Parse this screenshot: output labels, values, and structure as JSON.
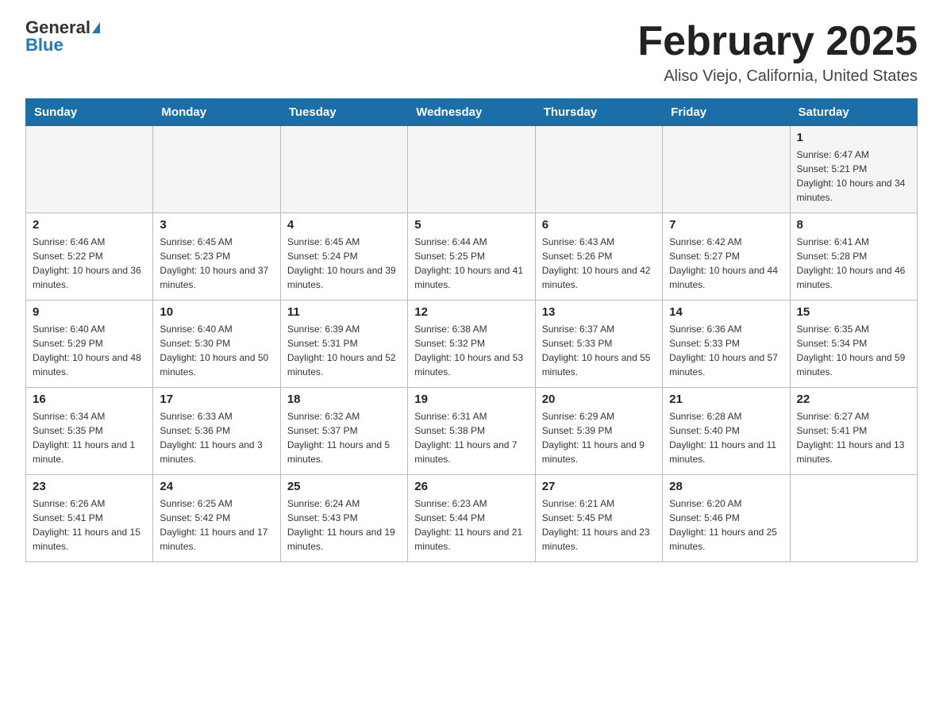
{
  "header": {
    "logo_general": "General",
    "logo_blue": "Blue",
    "month_title": "February 2025",
    "location": "Aliso Viejo, California, United States"
  },
  "days_of_week": [
    "Sunday",
    "Monday",
    "Tuesday",
    "Wednesday",
    "Thursday",
    "Friday",
    "Saturday"
  ],
  "weeks": [
    [
      {
        "day": "",
        "info": ""
      },
      {
        "day": "",
        "info": ""
      },
      {
        "day": "",
        "info": ""
      },
      {
        "day": "",
        "info": ""
      },
      {
        "day": "",
        "info": ""
      },
      {
        "day": "",
        "info": ""
      },
      {
        "day": "1",
        "info": "Sunrise: 6:47 AM\nSunset: 5:21 PM\nDaylight: 10 hours and 34 minutes."
      }
    ],
    [
      {
        "day": "2",
        "info": "Sunrise: 6:46 AM\nSunset: 5:22 PM\nDaylight: 10 hours and 36 minutes."
      },
      {
        "day": "3",
        "info": "Sunrise: 6:45 AM\nSunset: 5:23 PM\nDaylight: 10 hours and 37 minutes."
      },
      {
        "day": "4",
        "info": "Sunrise: 6:45 AM\nSunset: 5:24 PM\nDaylight: 10 hours and 39 minutes."
      },
      {
        "day": "5",
        "info": "Sunrise: 6:44 AM\nSunset: 5:25 PM\nDaylight: 10 hours and 41 minutes."
      },
      {
        "day": "6",
        "info": "Sunrise: 6:43 AM\nSunset: 5:26 PM\nDaylight: 10 hours and 42 minutes."
      },
      {
        "day": "7",
        "info": "Sunrise: 6:42 AM\nSunset: 5:27 PM\nDaylight: 10 hours and 44 minutes."
      },
      {
        "day": "8",
        "info": "Sunrise: 6:41 AM\nSunset: 5:28 PM\nDaylight: 10 hours and 46 minutes."
      }
    ],
    [
      {
        "day": "9",
        "info": "Sunrise: 6:40 AM\nSunset: 5:29 PM\nDaylight: 10 hours and 48 minutes."
      },
      {
        "day": "10",
        "info": "Sunrise: 6:40 AM\nSunset: 5:30 PM\nDaylight: 10 hours and 50 minutes."
      },
      {
        "day": "11",
        "info": "Sunrise: 6:39 AM\nSunset: 5:31 PM\nDaylight: 10 hours and 52 minutes."
      },
      {
        "day": "12",
        "info": "Sunrise: 6:38 AM\nSunset: 5:32 PM\nDaylight: 10 hours and 53 minutes."
      },
      {
        "day": "13",
        "info": "Sunrise: 6:37 AM\nSunset: 5:33 PM\nDaylight: 10 hours and 55 minutes."
      },
      {
        "day": "14",
        "info": "Sunrise: 6:36 AM\nSunset: 5:33 PM\nDaylight: 10 hours and 57 minutes."
      },
      {
        "day": "15",
        "info": "Sunrise: 6:35 AM\nSunset: 5:34 PM\nDaylight: 10 hours and 59 minutes."
      }
    ],
    [
      {
        "day": "16",
        "info": "Sunrise: 6:34 AM\nSunset: 5:35 PM\nDaylight: 11 hours and 1 minute."
      },
      {
        "day": "17",
        "info": "Sunrise: 6:33 AM\nSunset: 5:36 PM\nDaylight: 11 hours and 3 minutes."
      },
      {
        "day": "18",
        "info": "Sunrise: 6:32 AM\nSunset: 5:37 PM\nDaylight: 11 hours and 5 minutes."
      },
      {
        "day": "19",
        "info": "Sunrise: 6:31 AM\nSunset: 5:38 PM\nDaylight: 11 hours and 7 minutes."
      },
      {
        "day": "20",
        "info": "Sunrise: 6:29 AM\nSunset: 5:39 PM\nDaylight: 11 hours and 9 minutes."
      },
      {
        "day": "21",
        "info": "Sunrise: 6:28 AM\nSunset: 5:40 PM\nDaylight: 11 hours and 11 minutes."
      },
      {
        "day": "22",
        "info": "Sunrise: 6:27 AM\nSunset: 5:41 PM\nDaylight: 11 hours and 13 minutes."
      }
    ],
    [
      {
        "day": "23",
        "info": "Sunrise: 6:26 AM\nSunset: 5:41 PM\nDaylight: 11 hours and 15 minutes."
      },
      {
        "day": "24",
        "info": "Sunrise: 6:25 AM\nSunset: 5:42 PM\nDaylight: 11 hours and 17 minutes."
      },
      {
        "day": "25",
        "info": "Sunrise: 6:24 AM\nSunset: 5:43 PM\nDaylight: 11 hours and 19 minutes."
      },
      {
        "day": "26",
        "info": "Sunrise: 6:23 AM\nSunset: 5:44 PM\nDaylight: 11 hours and 21 minutes."
      },
      {
        "day": "27",
        "info": "Sunrise: 6:21 AM\nSunset: 5:45 PM\nDaylight: 11 hours and 23 minutes."
      },
      {
        "day": "28",
        "info": "Sunrise: 6:20 AM\nSunset: 5:46 PM\nDaylight: 11 hours and 25 minutes."
      },
      {
        "day": "",
        "info": ""
      }
    ]
  ]
}
